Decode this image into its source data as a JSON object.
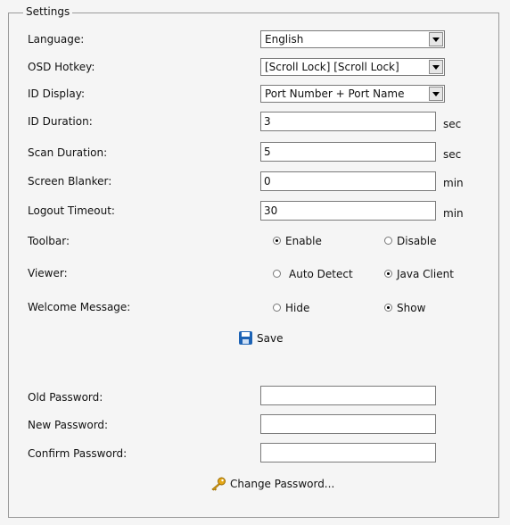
{
  "settings": {
    "legend": "Settings",
    "language": {
      "label": "Language:",
      "value": "English"
    },
    "osd_hotkey": {
      "label": "OSD Hotkey:",
      "value": "[Scroll Lock] [Scroll Lock]"
    },
    "id_display": {
      "label": "ID Display:",
      "value": "Port Number + Port Name"
    },
    "id_duration": {
      "label": "ID Duration:",
      "value": "3",
      "unit": "sec"
    },
    "scan_duration": {
      "label": "Scan Duration:",
      "value": "5",
      "unit": "sec"
    },
    "screen_blanker": {
      "label": "Screen Blanker:",
      "value": "0",
      "unit": "min"
    },
    "logout_timeout": {
      "label": "Logout Timeout:",
      "value": "30",
      "unit": "min"
    },
    "toolbar": {
      "label": "Toolbar:",
      "options": [
        "Enable",
        "Disable"
      ],
      "selected": "Enable"
    },
    "viewer": {
      "label": "Viewer:",
      "options": [
        "Auto Detect",
        "Java Client"
      ],
      "selected": "Java Client"
    },
    "welcome_message": {
      "label": "Welcome Message:",
      "options": [
        "Hide",
        "Show"
      ],
      "selected": "Show"
    },
    "save_label": "Save",
    "old_password": {
      "label": "Old Password:",
      "value": ""
    },
    "new_password": {
      "label": "New Password:",
      "value": ""
    },
    "confirm_password": {
      "label": "Confirm Password:",
      "value": ""
    },
    "change_password_label": "Change Password...",
    "icons": {
      "save": "save-icon",
      "change_password": "key-icon"
    },
    "colors": {
      "background": "#f5f5f5",
      "border": "#9a9a9a",
      "save_icon": "#1d63b5",
      "key_icon": "#e6a817"
    }
  }
}
